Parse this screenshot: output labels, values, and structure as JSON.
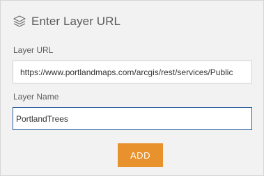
{
  "header": {
    "icon": "layers-icon",
    "title": "Enter Layer URL"
  },
  "layer_url": {
    "label": "Layer URL",
    "value": "https://www.portlandmaps.com/arcgis/rest/services/Public"
  },
  "layer_name": {
    "label": "Layer Name",
    "value": "PortlandTrees"
  },
  "add_button": {
    "label": "ADD"
  },
  "colors": {
    "accent": "#e8922d",
    "focus_border": "#2a5f9e",
    "panel_background": "#f2f2f2"
  }
}
